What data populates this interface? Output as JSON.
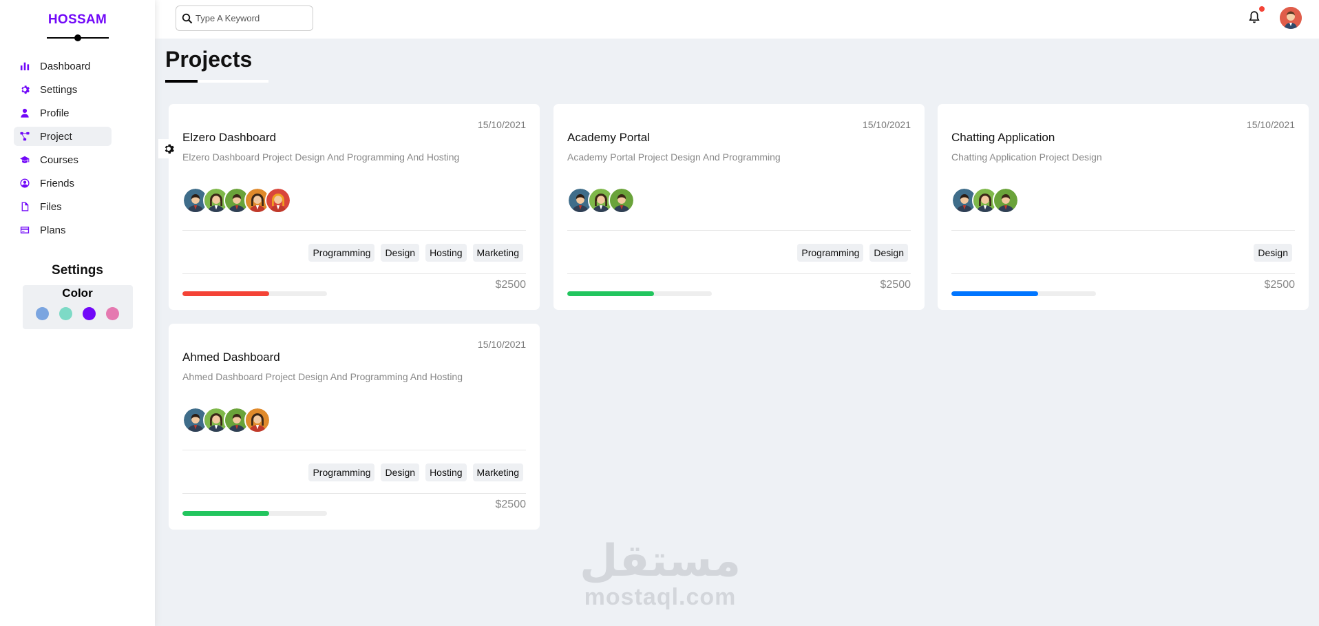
{
  "sidebar": {
    "brand": "HOSSAM",
    "items": [
      {
        "label": "Dashboard",
        "icon": "chart-bar-icon"
      },
      {
        "label": "Settings",
        "icon": "gear-icon"
      },
      {
        "label": "Profile",
        "icon": "user-icon"
      },
      {
        "label": "Project",
        "icon": "diagram-project-icon",
        "active": true
      },
      {
        "label": "Courses",
        "icon": "graduation-cap-icon"
      },
      {
        "label": "Friends",
        "icon": "circle-user-icon"
      },
      {
        "label": "Files",
        "icon": "file-icon"
      },
      {
        "label": "Plans",
        "icon": "credit-card-icon"
      }
    ],
    "settings_title": "Settings",
    "color_title": "Color",
    "swatches": [
      "#7ba5e0",
      "#7ddac6",
      "#7108f8",
      "#e579b0"
    ]
  },
  "header": {
    "search_placeholder": "Type A Keyword"
  },
  "page": {
    "title": "Projects"
  },
  "projects": [
    {
      "date": "15/10/2021",
      "title": "Elzero Dashboard",
      "desc": "Elzero Dashboard Project Design And Programming And Hosting",
      "avatars": 5,
      "tags": [
        "Programming",
        "Design",
        "Hosting",
        "Marketing"
      ],
      "progress": 0.6,
      "progress_color": "#f44336",
      "price": "$2500"
    },
    {
      "date": "15/10/2021",
      "title": "Academy Portal",
      "desc": "Academy Portal Project Design And Programming",
      "avatars": 3,
      "tags": [
        "Programming",
        "Design"
      ],
      "progress": 0.6,
      "progress_color": "#22c55e",
      "price": "$2500"
    },
    {
      "date": "15/10/2021",
      "title": "Chatting Application",
      "desc": "Chatting Application Project Design",
      "avatars": 3,
      "tags": [
        "Design"
      ],
      "progress": 0.6,
      "progress_color": "#0075ff",
      "price": "$2500"
    },
    {
      "date": "15/10/2021",
      "title": "Ahmed Dashboard",
      "desc": "Ahmed Dashboard Project Design And Programming And Hosting",
      "avatars": 4,
      "tags": [
        "Programming",
        "Design",
        "Hosting",
        "Marketing"
      ],
      "progress": 0.6,
      "progress_color": "#22c55e",
      "price": "$2500"
    }
  ],
  "watermark": {
    "arabic": "مستقل",
    "latin": "mostaql.com"
  }
}
